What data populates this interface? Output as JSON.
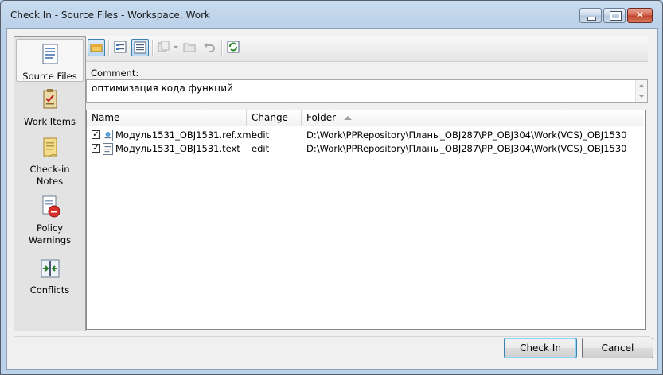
{
  "window": {
    "title": "Check In - Source Files - Workspace: Work",
    "controls": {
      "minimize_icon": "minimize-icon",
      "maximize_icon": "maximize-icon",
      "close_icon": "close-icon",
      "close_glyph": "✕"
    }
  },
  "nav": {
    "items": [
      {
        "label": "Source Files",
        "icon": "source-files-icon",
        "selected": true
      },
      {
        "label": "Work Items",
        "icon": "work-items-icon",
        "selected": false
      },
      {
        "label_line1": "Check-in",
        "label_line2": "Notes",
        "icon": "checkin-notes-icon",
        "selected": false
      },
      {
        "label_line1": "Policy",
        "label_line2": "Warnings",
        "icon": "policy-warnings-icon",
        "selected": false
      },
      {
        "label": "Conflicts",
        "icon": "conflicts-icon",
        "selected": false
      }
    ]
  },
  "toolbar": {
    "buttons": [
      "shelve-icon",
      "list-view-icon",
      "details-view-icon",
      "compare-icon",
      "open-folder-icon",
      "undo-icon",
      "refresh-icon"
    ]
  },
  "comment": {
    "label": "Comment:",
    "value": "оптимизация кода функций"
  },
  "files": {
    "columns": {
      "name": "Name",
      "change": "Change",
      "folder": "Folder"
    },
    "sort_column": "Folder",
    "rows": [
      {
        "checked": true,
        "name": "Модуль1531_OBJ1531.ref.xml",
        "change": "edit",
        "folder": "D:\\Work\\PPRepository\\Планы_OBJ287\\PP_OBJ304\\Work(VCS)_OBJ1530"
      },
      {
        "checked": true,
        "name": "Модуль1531_OBJ1531.text",
        "change": "edit",
        "folder": "D:\\Work\\PPRepository\\Планы_OBJ287\\PP_OBJ304\\Work(VCS)_OBJ1530"
      }
    ]
  },
  "buttons": {
    "check_in": "Check In",
    "cancel": "Cancel"
  },
  "colors": {
    "accent": "#3c7fb1",
    "title_bg": "#c9dcef",
    "close_red": "#c0412b"
  }
}
